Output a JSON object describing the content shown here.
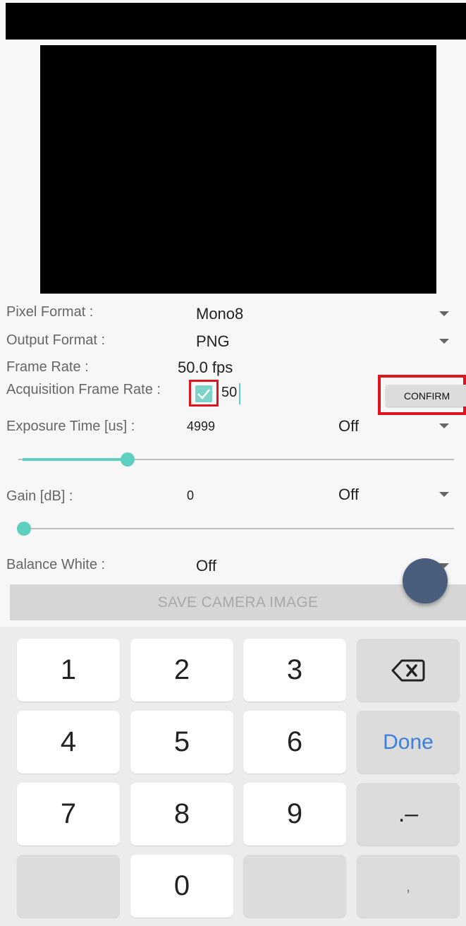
{
  "settings": {
    "pixel_format": {
      "label": "Pixel Format :",
      "value": "Mono8"
    },
    "output_format": {
      "label": "Output Format :",
      "value": "PNG"
    },
    "frame_rate": {
      "label": "Frame Rate :",
      "value": "50.0 fps"
    },
    "acquisition_frame_rate": {
      "label": "Acquisition Frame Rate :",
      "enabled": true,
      "input_value": "50",
      "confirm_label": "CONFIRM"
    },
    "exposure_time": {
      "label": "Exposure Time [us] :",
      "value": "4999",
      "auto": "Off",
      "slider_level": 0.25
    },
    "gain": {
      "label": "Gain [dB] :",
      "value": "0",
      "auto": "Off",
      "slider_level": 0.0
    },
    "balance_white": {
      "label": "Balance White :",
      "value": "Off"
    }
  },
  "save_button_label": "SAVE CAMERA IMAGE",
  "keyboard": {
    "rows": [
      [
        "1",
        "2",
        "3",
        ""
      ],
      [
        "4",
        "5",
        "6",
        "Done"
      ],
      [
        "7",
        "8",
        "9",
        ".–"
      ],
      [
        "",
        "0",
        "",
        ","
      ]
    ]
  },
  "colors": {
    "accent": "#5fcfbf",
    "highlight": "#e0141e",
    "fab": "#4a5d7c",
    "done": "#3d7fdd"
  }
}
